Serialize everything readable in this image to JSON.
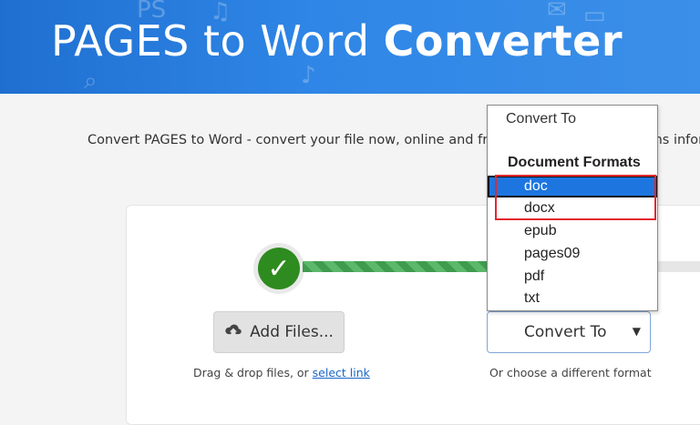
{
  "banner": {
    "title_prefix": "PAGES to Word ",
    "title_bold": "Converter",
    "doodle_ps": "PS"
  },
  "intro_text": "Convert PAGES to Word - convert your file now, online and free - this page also contains information",
  "upload": {
    "add_files_label": "Add Files...",
    "drag_text": "Drag & drop files, or ",
    "select_link": "select link"
  },
  "convert": {
    "select_label": "Convert To",
    "choose_text": "Or choose a different format"
  },
  "dropdown": {
    "header": "Convert To",
    "group_label": "Document Formats",
    "options": [
      "doc",
      "docx",
      "epub",
      "pages09",
      "pdf",
      "txt"
    ],
    "selected": "doc"
  },
  "colors": {
    "banner": "#2f86e6",
    "success": "#2e8b1f",
    "progress": "#3f9c4e",
    "selected_option": "#1d76e0",
    "highlight_border": "#e3282d",
    "link": "#1a66c9"
  },
  "icons": {
    "step_done": "check-icon",
    "add_files": "cloud-upload-icon",
    "select": "chevron-down-icon"
  }
}
